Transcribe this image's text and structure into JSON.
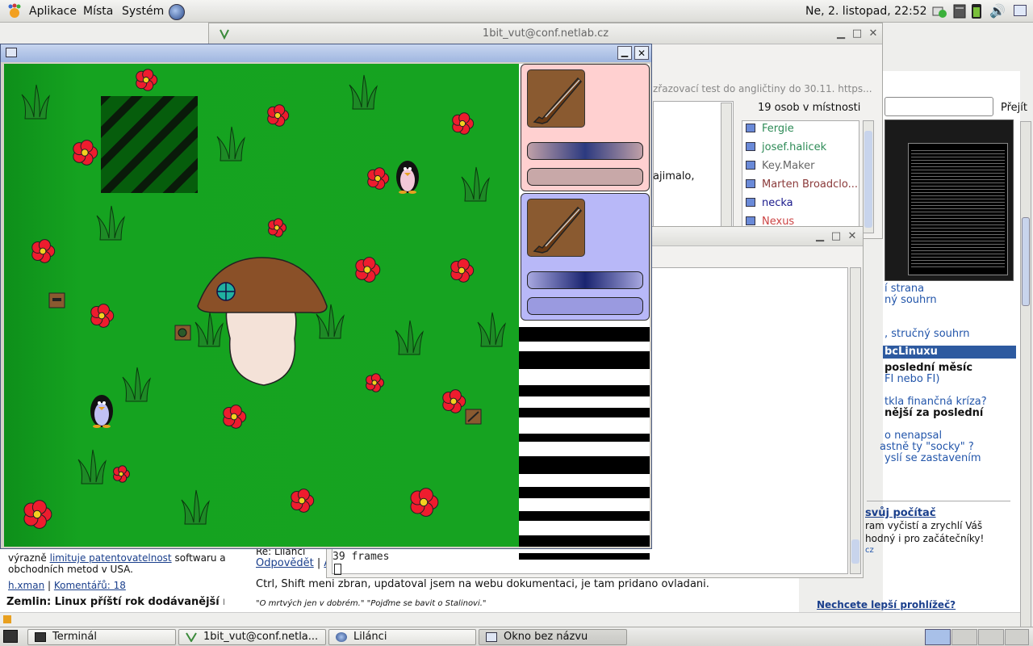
{
  "top_panel": {
    "menus": [
      "Aplikace",
      "Místa",
      "Systém"
    ],
    "clock": "Ne,  2. listopad, 22:52"
  },
  "chat_window": {
    "title": "1bit_vut@conf.netlab.cz",
    "topic": "zřazovací test do angličtiny do 30.11. https...",
    "occupants_label": "19 osob v místnosti",
    "members": [
      {
        "name": "Fergie",
        "color": "#2e8b57"
      },
      {
        "name": "josef.halicek",
        "color": "#2e8b57"
      },
      {
        "name": "Key.Maker",
        "color": "#666666"
      },
      {
        "name": "Marten Broadclo...",
        "color": "#8b3a3a"
      },
      {
        "name": "necka",
        "color": "#1a1a8c"
      },
      {
        "name": "Nexus",
        "color": "#cc4444"
      }
    ],
    "message_fragment": "ajimalo,"
  },
  "browser": {
    "search_button": "Přejít",
    "right_links": [
      "í strana",
      "ný souhrn",
      ", stručný souhrn"
    ],
    "section_header": "bcLinuxu",
    "bold_title": "poslední měsíc",
    "sub_title": "FI nebo FI)",
    "links2": [
      "tkla finančná kríza?"
    ],
    "bold2": "nější za poslední",
    "links3": [
      "o nenapsal",
      "astně ty \"socky\" ?",
      "yslí se zastavením"
    ],
    "promo_link": "svůj počítač",
    "promo_text1": "ram vyčistí a zrychlí Váš",
    "promo_text2": "hodný i pro začátečníky!",
    "promo_small": "cz",
    "bottom_link": "Nechcete lepší prohlížeč?",
    "left_text1": "výrazně",
    "left_link1": "limituje patentovatelnost",
    "left_text2": "softwaru a",
    "left_text3": "obchodních metod v USA.",
    "left_author": "h.xman",
    "left_comments": "Komentářů: 18",
    "left_headline": "Zemlin: Linux příští rok dodávanější r",
    "post_title": "Re: Lilánci",
    "reply_link": "Odpovědět",
    "reply_link2": "A",
    "comment": "Ctrl, Shift meni zbran, updatoval jsem na webu dokumentaci, je tam pridano ovladani.",
    "signature": "\"O mrtvých jen v dobrém.\" \"Pojďme se bavit o Stalinovi.\""
  },
  "terminal": {
    "output": "39 frames"
  },
  "taskbar": {
    "items": [
      "Terminál",
      "1bit_vut@conf.netla...",
      "Lilánci",
      "Okno bez názvu"
    ]
  },
  "game": {
    "player1_card_color": "#ffd0d0",
    "player2_card_color": "#b8b8f8",
    "field_color": "#16a321"
  }
}
